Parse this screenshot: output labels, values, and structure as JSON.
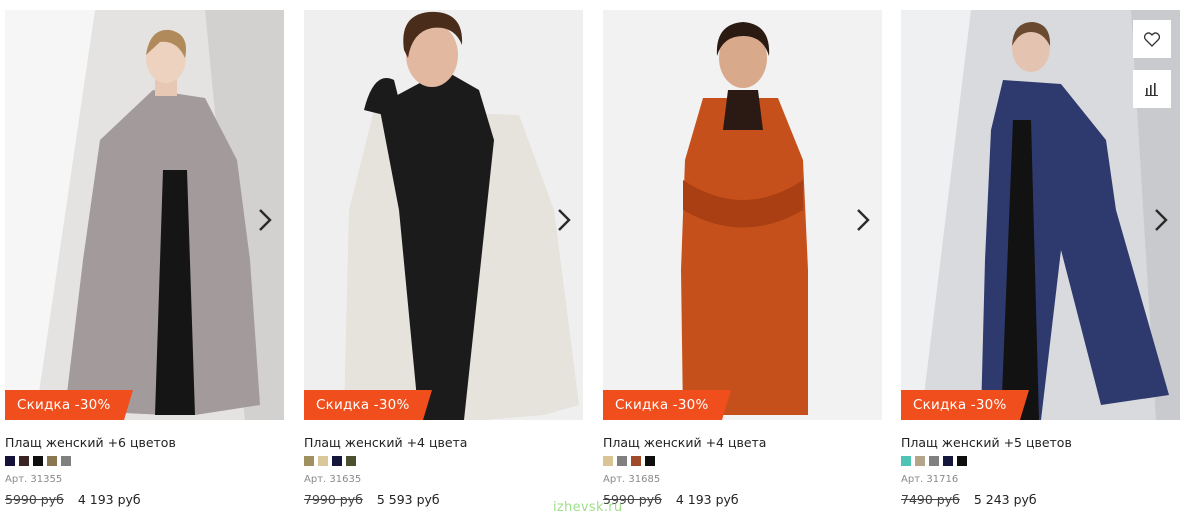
{
  "products": [
    {
      "title": "Плащ женский +6 цветов",
      "badge": "Скидка -30%",
      "article": "Арт. 31355",
      "old_price": "5990 руб",
      "new_price": "4 193 руб",
      "swatches": [
        "#141238",
        "#3a2323",
        "#0e0e0e",
        "#8a7650",
        "#808080"
      ],
      "coat_color": "#a39a9c",
      "bg_color": "#e4e3e1"
    },
    {
      "title": "Плащ женский +4 цвета",
      "badge": "Скидка -30%",
      "article": "Арт. 31635",
      "old_price": "7990 руб",
      "new_price": "5 593 руб",
      "swatches": [
        "#a09060",
        "#d8c89a",
        "#13163a",
        "#4a5030"
      ],
      "coat_color": "#e6e2dc",
      "bg_color": "#efefef"
    },
    {
      "title": "Плащ женский +4 цвета",
      "badge": "Скидка -30%",
      "article": "Арт. 31685",
      "old_price": "5990 руб",
      "new_price": "4 193 руб",
      "swatches": [
        "#d8c494",
        "#808080",
        "#a04a2c",
        "#0e0e0e"
      ],
      "coat_color": "#c6501b",
      "bg_color": "#f2f2f2"
    },
    {
      "title": "Плащ женский +5 цветов",
      "badge": "Скидка -30%",
      "article": "Арт. 31716",
      "old_price": "7490 руб",
      "new_price": "5 243 руб",
      "swatches": [
        "#4fc3b5",
        "#b3a48a",
        "#808080",
        "#14163c",
        "#0e0e0e"
      ],
      "coat_color": "#2e3a6e",
      "bg_color": "#d9dadd"
    }
  ],
  "icons": {
    "favorite": "heart-icon",
    "compare": "bar-chart-icon",
    "next": "chevron-right-icon"
  },
  "accent_color": "#f04e1c",
  "watermark": "izhevsk.ru"
}
